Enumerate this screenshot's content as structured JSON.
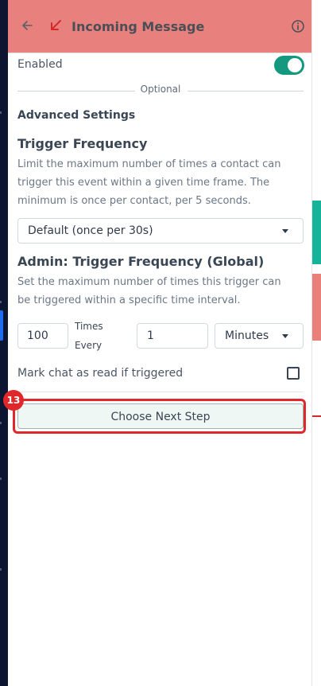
{
  "header": {
    "title": "Incoming Message",
    "back_icon": "arrow-left-icon",
    "type_icon": "arrow-down-left-icon",
    "info_icon": "info-circle-icon",
    "background": "#e8817d"
  },
  "enabled": {
    "label": "Enabled",
    "value": true,
    "accent": "#14987e"
  },
  "divider": {
    "label": "Optional"
  },
  "advanced": {
    "heading": "Advanced Settings"
  },
  "trigger_frequency": {
    "heading": "Trigger Frequency",
    "description_lines": [
      "Limit the maximum number of times a contact can",
      "trigger this event within a given time frame. The",
      "minimum is once per contact, per 5 seconds."
    ],
    "selected": "Default (once per 30s)"
  },
  "admin_frequency": {
    "heading": "Admin: Trigger Frequency (Global)",
    "description_lines": [
      "Set the maximum number of times this trigger can",
      "be triggered within a specific time interval."
    ],
    "times_value": "100",
    "times_label": "Times",
    "every_label": "Every",
    "interval_value": "1",
    "unit_selected": "Minutes"
  },
  "mark_read": {
    "label": "Mark chat as read if triggered",
    "checked": false
  },
  "next_step": {
    "label": "Choose Next Step",
    "badge": "13",
    "highlight_color": "#e0282b"
  }
}
